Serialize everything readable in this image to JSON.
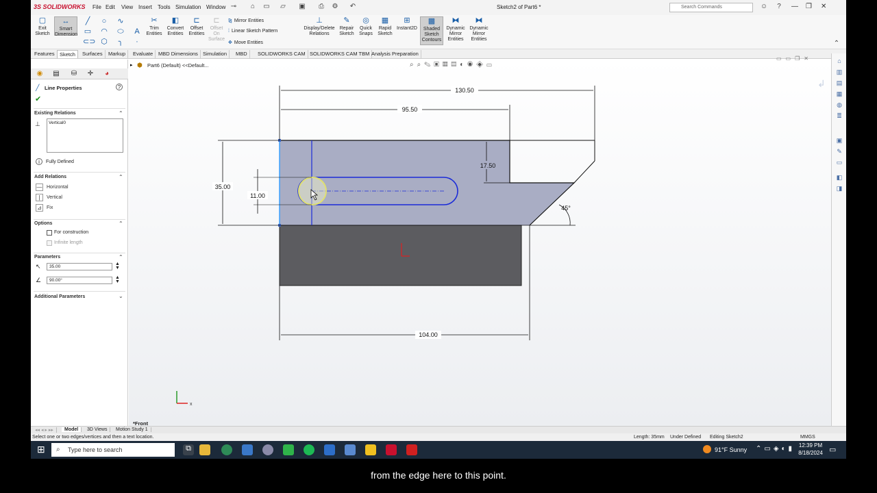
{
  "titlebar": {
    "logo": "3S SOLIDWORKS",
    "menus": [
      "File",
      "Edit",
      "View",
      "Insert",
      "Tools",
      "Simulation",
      "Window"
    ],
    "doc_title": "Sketch2 of Part6 *",
    "search_placeholder": "Search Commands"
  },
  "ribbon": {
    "exit_sketch": "Exit Sketch",
    "smart_dimension": "Smart Dimension",
    "trim": "Trim Entities",
    "convert": "Convert Entities",
    "offset": "Offset Entities",
    "offset_surface": "Offset On Surface",
    "mirror": "Mirror Entities",
    "linear_pattern": "Linear Sketch Pattern",
    "move": "Move Entities",
    "display_delete": "Display/Delete Relations",
    "repair": "Repair Sketch",
    "quick_snaps": "Quick Snaps",
    "rapid_sketch": "Rapid Sketch",
    "instant2d": "Instant2D",
    "shaded_contours": "Shaded Sketch Contours",
    "dyn_mirror1": "Dynamic Mirror Entities",
    "dyn_mirror2": "Dynamic Mirror Entities"
  },
  "tabs": [
    "Features",
    "Sketch",
    "Surfaces",
    "Markup",
    "Evaluate",
    "MBD Dimensions",
    "Simulation",
    "MBD",
    "SOLIDWORKS CAM",
    "SOLIDWORKS CAM TBM",
    "Analysis Preparation"
  ],
  "panel": {
    "title": "Line Properties",
    "existing_relations": "Existing Relations",
    "relation_value": "Vertical0",
    "status": "Fully Defined",
    "add_relations": "Add Relations",
    "horizontal": "Horizontal",
    "vertical": "Vertical",
    "fix": "Fix",
    "options": "Options",
    "for_construction": "For construction",
    "infinite_length": "Infinite length",
    "parameters": "Parameters",
    "length": "35.00",
    "angle": "90.00°",
    "additional": "Additional Parameters"
  },
  "canvas": {
    "breadcrumb": "Part6 (Default) <<Default...",
    "view_label": "*Front",
    "dims": {
      "d130": "130.50",
      "d95": "95.50",
      "d17": "17.50",
      "d35": "35.00",
      "d11": "11.00",
      "d45": "45°",
      "d104": "104.00"
    }
  },
  "bottom_tabs": [
    "Model",
    "3D Views",
    "Motion Study 1"
  ],
  "status": {
    "hint": "Select one or two edges/vertices and then a text location.",
    "length": "Length: 35mm",
    "defined": "Under Defined",
    "editing": "Editing Sketch2",
    "units": "MMGS"
  },
  "taskbar": {
    "search": "Type here to search",
    "weather": "91°F  Sunny",
    "time": "12:39 PM",
    "date": "8/18/2024"
  },
  "subtitle": "from the edge here to this point."
}
